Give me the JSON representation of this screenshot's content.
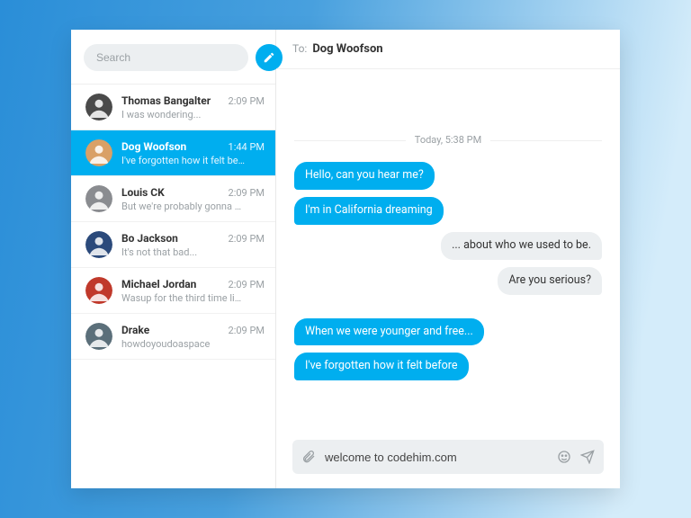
{
  "search": {
    "placeholder": "Search"
  },
  "conversations": [
    {
      "name": "Thomas Bangalter",
      "time": "2:09 PM",
      "preview": "I was wondering...",
      "active": false,
      "avatar": "#4a4a4a"
    },
    {
      "name": "Dog Woofson",
      "time": "1:44 PM",
      "preview": "I've forgotten how it felt be…",
      "active": true,
      "avatar": "#d9a066"
    },
    {
      "name": "Louis CK",
      "time": "2:09 PM",
      "preview": "But we're probably gonna …",
      "active": false,
      "avatar": "#8a8c90"
    },
    {
      "name": "Bo Jackson",
      "time": "2:09 PM",
      "preview": "It's not that bad...",
      "active": false,
      "avatar": "#2b4a7b"
    },
    {
      "name": "Michael Jordan",
      "time": "2:09 PM",
      "preview": "Wasup for the third time li…",
      "active": false,
      "avatar": "#c0392b"
    },
    {
      "name": "Drake",
      "time": "2:09 PM",
      "preview": "howdoyoudoaspace",
      "active": false,
      "avatar": "#5b6f7a"
    }
  ],
  "chat": {
    "to_label": "To:",
    "to_name": "Dog Woofson",
    "timestamp": "Today, 5:38 PM",
    "messages": [
      {
        "side": "me",
        "text": "Hello, can you hear me?"
      },
      {
        "side": "me",
        "text": "I'm in California dreaming"
      },
      {
        "side": "you",
        "text": "... about who we used to be."
      },
      {
        "side": "you",
        "text": "Are you serious?"
      },
      {
        "side": "gap"
      },
      {
        "side": "me",
        "text": "When we were younger and free..."
      },
      {
        "side": "me",
        "text": "I've forgotten how it felt before"
      }
    ]
  },
  "composer": {
    "value": "welcome to codehim.com"
  }
}
